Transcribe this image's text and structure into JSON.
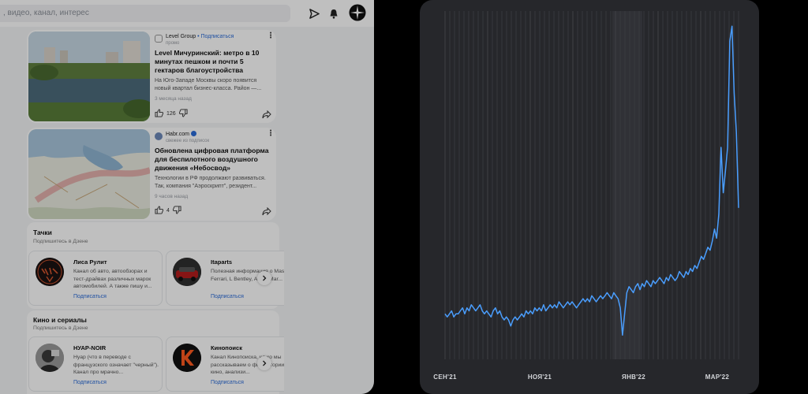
{
  "search": {
    "text": ", видео, канал, интерес"
  },
  "topbar": {
    "icons": [
      "send-icon",
      "bell-icon",
      "compass-icon"
    ]
  },
  "feed": [
    {
      "source": "Level Group",
      "subscribe": " • Подписаться",
      "note": "промо",
      "title": "Level Мичуринский: метро в 10 минутах пешком и почти 5 гектаров благоустройства",
      "snippet": "На Юго-Западе Москвы скоро появится новый квартал бизнес-класса. Район —...",
      "time": "3 месяца назад",
      "likes": "126"
    },
    {
      "source": "Habr.com",
      "subscribe": "",
      "note": "свежее из подписок",
      "title": "Обновлена цифровая платформа для беспилотного воздушного движения «Небосвод»",
      "snippet": "Технологии в РФ продолжают развиваться. Так, компания \"Аэроскрипт\", резидент...",
      "time": "9 часов назад",
      "likes": "4"
    }
  ],
  "blocks": [
    {
      "title": "Тачки",
      "subtitle": "Подпишитесь в Дзене",
      "channels": [
        {
          "name": "Лиса Рулит",
          "desc": "Канал об авто, автообзорах и тест-драйвах различных марок автомобилей. А также пишу и...",
          "subscribe": "Подписаться"
        },
        {
          "name": "Itaparts",
          "desc": "Полезная информация о Maserati, Ferrari, L Bentley, Aston Mar...",
          "subscribe": "Подписаться"
        }
      ]
    },
    {
      "title": "Кино и сериалы",
      "subtitle": "Подпишитесь в Дзене",
      "channels": [
        {
          "name": "НУАР-NOIR",
          "desc": "Нуар (что в переводе с французского означает \"черный\"). Канал про мрачно...",
          "subscribe": "Подписаться"
        },
        {
          "name": "Кинопоиск",
          "desc": "Канал Кинопоиска, на ко мы рассказываем о фил истории кино, анализи...",
          "subscribe": "Подписаться"
        }
      ]
    }
  ],
  "colors": {
    "line": "#4a9eff",
    "panel": "#26272b",
    "grid": "#3c3d42",
    "link": "#2a6bd8"
  },
  "chart_data": {
    "type": "line",
    "title": "",
    "xlabel": "",
    "ylabel": "",
    "x_ticks": [
      "СЕН'21",
      "НОЯ'21",
      "ЯНВ'22",
      "МАР'22"
    ],
    "grid": "vertical",
    "series": [
      {
        "values": [
          0.05,
          0.04,
          0.05,
          0.06,
          0.04,
          0.05,
          0.05,
          0.06,
          0.07,
          0.05,
          0.07,
          0.06,
          0.08,
          0.07,
          0.06,
          0.07,
          0.08,
          0.06,
          0.05,
          0.06,
          0.05,
          0.04,
          0.06,
          0.07,
          0.05,
          0.06,
          0.04,
          0.03,
          0.04,
          0.03,
          0.01,
          0.03,
          0.04,
          0.03,
          0.04,
          0.05,
          0.04,
          0.06,
          0.05,
          0.06,
          0.05,
          0.07,
          0.06,
          0.07,
          0.06,
          0.08,
          0.06,
          0.07,
          0.08,
          0.07,
          0.08,
          0.07,
          0.09,
          0.08,
          0.07,
          0.08,
          0.09,
          0.08,
          0.09,
          0.08,
          0.07,
          0.08,
          0.09,
          0.1,
          0.09,
          0.1,
          0.09,
          0.11,
          0.1,
          0.09,
          0.1,
          0.11,
          0.1,
          0.11,
          0.12,
          0.11,
          0.1,
          0.12,
          0.11,
          0.1,
          0.07,
          -0.02,
          0.05,
          0.12,
          0.14,
          0.13,
          0.12,
          0.14,
          0.15,
          0.13,
          0.15,
          0.14,
          0.16,
          0.15,
          0.14,
          0.16,
          0.15,
          0.16,
          0.17,
          0.16,
          0.15,
          0.17,
          0.16,
          0.18,
          0.17,
          0.16,
          0.17,
          0.19,
          0.18,
          0.17,
          0.19,
          0.18,
          0.2,
          0.19,
          0.21,
          0.2,
          0.22,
          0.24,
          0.23,
          0.25,
          0.27,
          0.26,
          0.29,
          0.33,
          0.3,
          0.38,
          0.6,
          0.45,
          0.52,
          0.6,
          0.95,
          1.0,
          0.78,
          0.65,
          0.4
        ]
      }
    ],
    "ylim": [
      -0.1,
      1.05
    ]
  }
}
